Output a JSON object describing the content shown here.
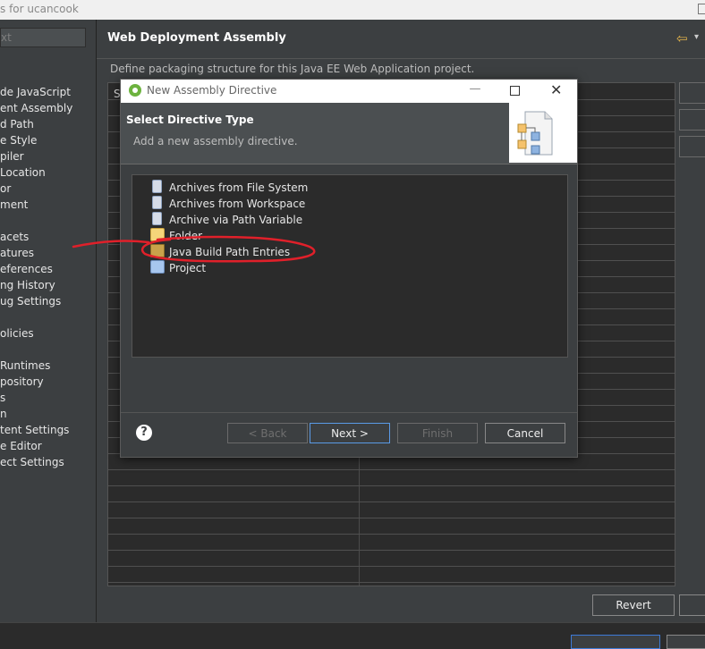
{
  "window": {
    "title": "s for ucancook"
  },
  "filter": {
    "placeholder": "xt"
  },
  "nav": {
    "items": [
      "de JavaScript",
      "ent Assembly",
      "d Path",
      "e Style",
      "piler",
      "Location",
      "or",
      "ment",
      "",
      "acets",
      "atures",
      "eferences",
      "ng History",
      "ug Settings",
      "",
      "olicies",
      "",
      "Runtimes",
      "pository",
      "s",
      "n",
      "tent Settings",
      "e Editor",
      "ect Settings"
    ]
  },
  "page": {
    "title": "Web Deployment Assembly",
    "description": "Define packaging structure for this Java EE Web Application project.",
    "grid_header": "S",
    "revert_label": "Revert"
  },
  "dialog": {
    "title": "New Assembly Directive",
    "header": "Select Directive Type",
    "subtitle": "Add a new assembly directive.",
    "items": [
      {
        "label": "Archives from File System",
        "icon": "archive-icon"
      },
      {
        "label": "Archives from Workspace",
        "icon": "archive-icon"
      },
      {
        "label": "Archive via Path Variable",
        "icon": "archive-icon"
      },
      {
        "label": "Folder",
        "icon": "folder-icon"
      },
      {
        "label": "Java Build Path Entries",
        "icon": "library-icon"
      },
      {
        "label": "Project",
        "icon": "project-folder-icon"
      }
    ],
    "buttons": {
      "back": "< Back",
      "next": "Next >",
      "finish": "Finish",
      "cancel": "Cancel"
    },
    "help": "?"
  },
  "colors": {
    "annotation": "#e0202a",
    "spring": "#6db33f",
    "focus": "#5a9ae6"
  }
}
